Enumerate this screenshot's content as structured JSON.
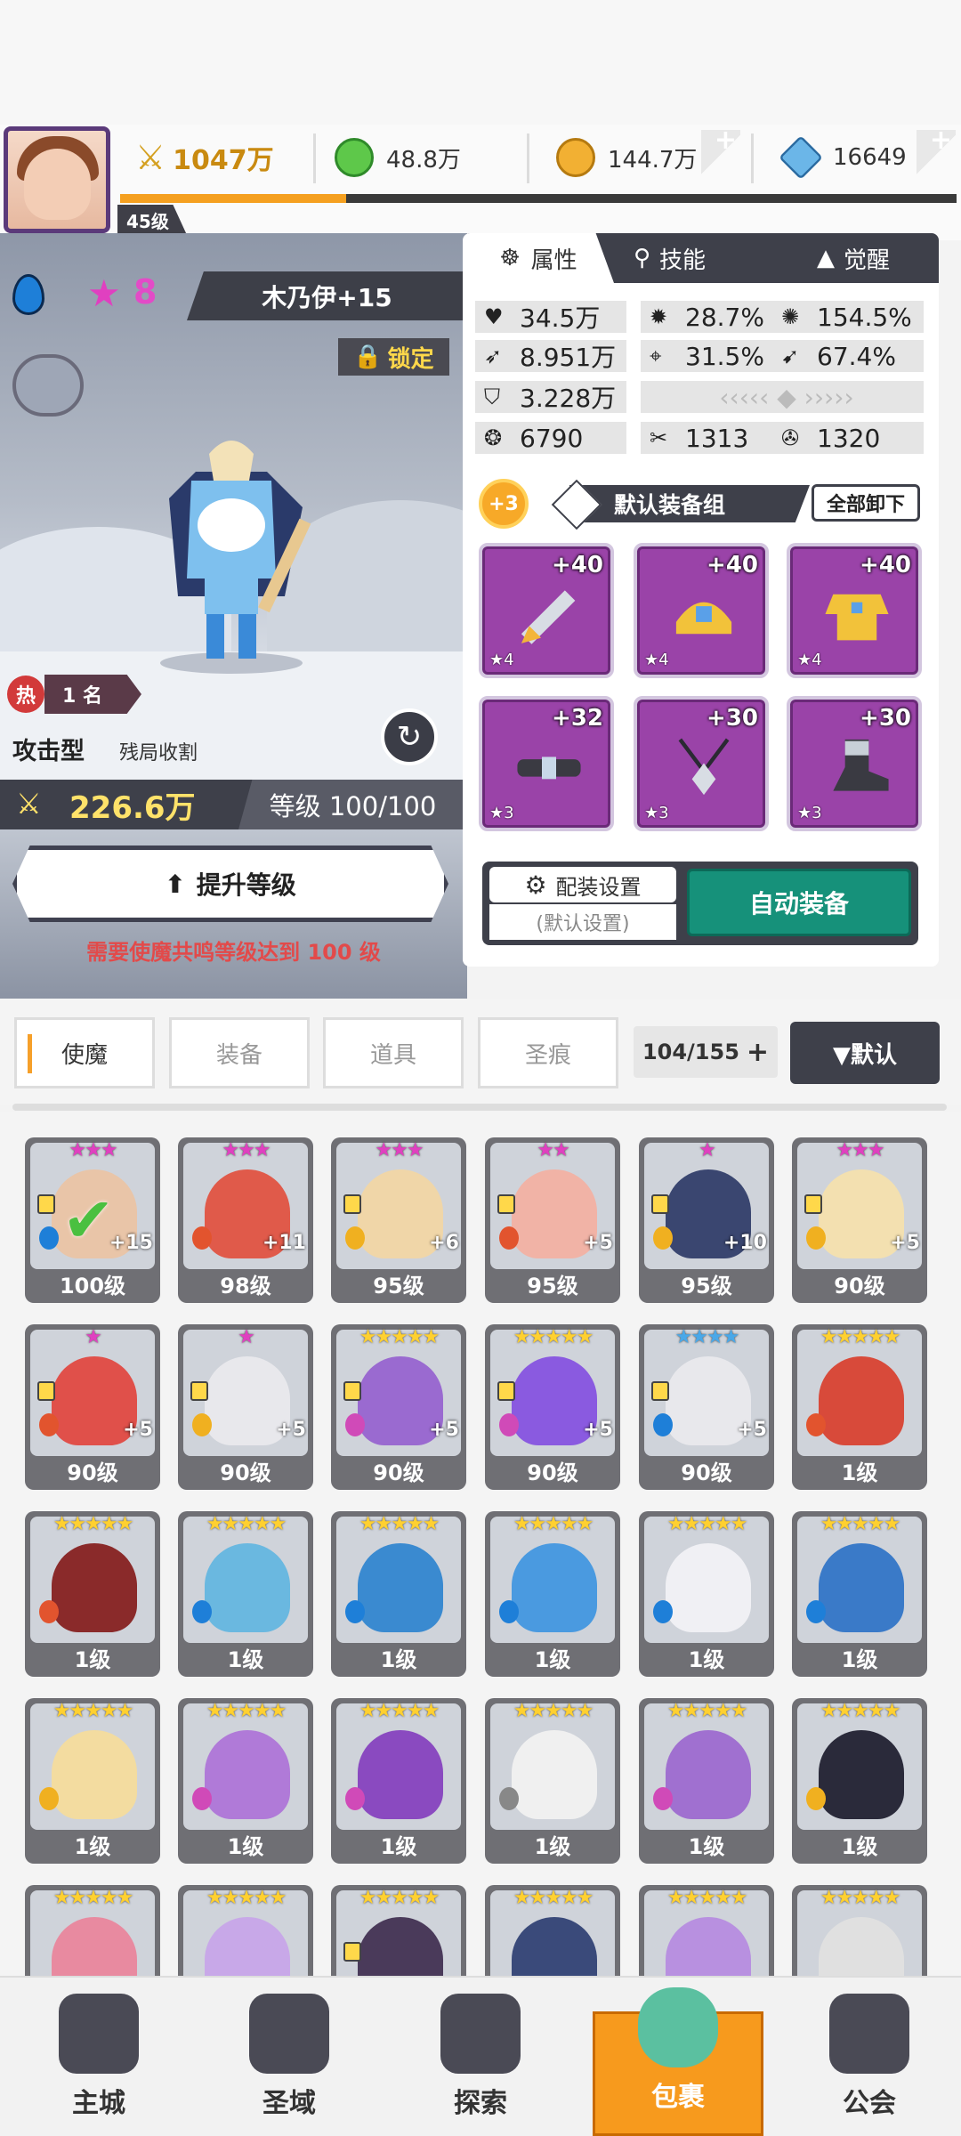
{
  "header": {
    "combat_power": "1047万",
    "currencies": [
      {
        "name": "green-gem",
        "value": "48.8万",
        "color": "#5ec84a"
      },
      {
        "name": "gold-coin",
        "value": "144.7万",
        "color": "#f2b033"
      },
      {
        "name": "blue-crystal",
        "value": "16649",
        "color": "#6bb6e8"
      }
    ],
    "player_level": "45级",
    "xp_progress": 0.27
  },
  "hero": {
    "stars": "8",
    "name": "木乃伊+15",
    "lock_label": "锁定",
    "rank_label": "1 名",
    "rank_icon": "热",
    "type": "攻击型",
    "type_desc": "残局收割",
    "power": "226.6万",
    "level": "等级 100/100",
    "upgrade_label": "提升等级",
    "warning": "需要使魔共鸣等级达到 100 级"
  },
  "attr_panel": {
    "tabs": {
      "attributes": "属性",
      "skills": "技能",
      "awaken": "觉醒"
    },
    "stats": [
      {
        "icon": "heart-icon",
        "glyph": "♥",
        "value": "34.5万"
      },
      {
        "icon": "crit-icon",
        "glyph": "✹",
        "value": "28.7%"
      },
      {
        "icon": "crit-damage-icon",
        "glyph": "✺",
        "value": "154.5%"
      },
      {
        "icon": "attack-icon",
        "glyph": "➶",
        "value": "8.951万"
      },
      {
        "icon": "accuracy-icon",
        "glyph": "⌖",
        "value": "31.5%"
      },
      {
        "icon": "dodge-icon",
        "glyph": "➹",
        "value": "67.4%"
      },
      {
        "icon": "shield-icon",
        "glyph": "⛉",
        "value": "3.228万"
      },
      {
        "icon": "speed-icon",
        "glyph": "❂",
        "value": "6790"
      },
      {
        "icon": "skill-a-icon",
        "glyph": "✂",
        "value": "1313"
      },
      {
        "icon": "skill-b-icon",
        "glyph": "✇",
        "value": "1320"
      }
    ],
    "gear_group_badge": "+3",
    "gear_group_name": "默认装备组",
    "unequip_all": "全部卸下",
    "equipment": [
      {
        "name": "sword",
        "level": "+40",
        "stars": "★4"
      },
      {
        "name": "helmet",
        "level": "+40",
        "stars": "★4"
      },
      {
        "name": "armor",
        "level": "+40",
        "stars": "★4"
      },
      {
        "name": "belt",
        "level": "+32",
        "stars": "★3"
      },
      {
        "name": "necklace",
        "level": "+30",
        "stars": "★3"
      },
      {
        "name": "boots",
        "level": "+30",
        "stars": "★3"
      }
    ],
    "config_label": "配装设置",
    "config_sub": "(默认设置)",
    "auto_equip": "自动装备"
  },
  "inventory": {
    "tabs": [
      "使魔",
      "装备",
      "道具",
      "圣痕"
    ],
    "count": "104/155",
    "sort": "▼默认"
  },
  "heroes": [
    {
      "stars": "★★★",
      "star_color": "#e040c0",
      "level": "100级",
      "plus": "+15",
      "locked": true,
      "element": "#1e7fd8",
      "color": "#e9c5a8"
    },
    {
      "stars": "★★★",
      "star_color": "#e040c0",
      "level": "98级",
      "plus": "+11",
      "locked": false,
      "element": "#e2542e",
      "color": "#e05a4a"
    },
    {
      "stars": "★★★",
      "star_color": "#e040c0",
      "level": "95级",
      "plus": "+6",
      "locked": true,
      "element": "#f0b020",
      "color": "#f0d6a8"
    },
    {
      "stars": "★★",
      "star_color": "#e040c0",
      "level": "95级",
      "plus": "+5",
      "locked": true,
      "element": "#e2542e",
      "color": "#f1b3a6"
    },
    {
      "stars": "★",
      "star_color": "#e040c0",
      "level": "95级",
      "plus": "+10",
      "locked": true,
      "element": "#f0b020",
      "color": "#3a4670"
    },
    {
      "stars": "★★★",
      "star_color": "#e040c0",
      "level": "90级",
      "plus": "+5",
      "locked": true,
      "element": "#f0b020",
      "color": "#f3e0b0"
    },
    {
      "stars": "★",
      "star_color": "#e040c0",
      "level": "90级",
      "plus": "+5",
      "locked": true,
      "element": "#e2542e",
      "color": "#e0504a"
    },
    {
      "stars": "★",
      "star_color": "#e040c0",
      "level": "90级",
      "plus": "+5",
      "locked": true,
      "element": "#f0b020",
      "color": "#e8e8ec"
    },
    {
      "stars": "★★★★★",
      "star_color": "#ffd030",
      "level": "90级",
      "plus": "+5",
      "locked": true,
      "element": "#d04ab8",
      "color": "#9a6ad0"
    },
    {
      "stars": "★★★★★",
      "star_color": "#ffd030",
      "level": "90级",
      "plus": "+5",
      "locked": true,
      "element": "#d04ab8",
      "color": "#8a5ae0"
    },
    {
      "stars": "★★★★",
      "star_color": "#4aa8e8",
      "level": "90级",
      "plus": "+5",
      "locked": true,
      "element": "#1e7fd8",
      "color": "#e8e8ec"
    },
    {
      "stars": "★★★★★",
      "star_color": "#ffd030",
      "level": "1级",
      "plus": "",
      "locked": false,
      "element": "#e2542e",
      "color": "#d84a3a"
    },
    {
      "stars": "★★★★★",
      "star_color": "#ffd030",
      "level": "1级",
      "plus": "",
      "locked": false,
      "element": "#e2542e",
      "color": "#8a2a2a"
    },
    {
      "stars": "★★★★★",
      "star_color": "#ffd030",
      "level": "1级",
      "plus": "",
      "locked": false,
      "element": "#1e7fd8",
      "color": "#6ab8e0"
    },
    {
      "stars": "★★★★★",
      "star_color": "#ffd030",
      "level": "1级",
      "plus": "",
      "locked": false,
      "element": "#1e7fd8",
      "color": "#3a8ad0"
    },
    {
      "stars": "★★★★★",
      "star_color": "#ffd030",
      "level": "1级",
      "plus": "",
      "locked": false,
      "element": "#1e7fd8",
      "color": "#4a9ae0"
    },
    {
      "stars": "★★★★★",
      "star_color": "#ffd030",
      "level": "1级",
      "plus": "",
      "locked": false,
      "element": "#1e7fd8",
      "color": "#f0f0f4"
    },
    {
      "stars": "★★★★★",
      "star_color": "#ffd030",
      "level": "1级",
      "plus": "",
      "locked": false,
      "element": "#1e7fd8",
      "color": "#3a7ac8"
    },
    {
      "stars": "★★★★★",
      "star_color": "#ffd030",
      "level": "1级",
      "plus": "",
      "locked": false,
      "element": "#f0b020",
      "color": "#f3dca0"
    },
    {
      "stars": "★★★★★",
      "star_color": "#ffd030",
      "level": "1级",
      "plus": "",
      "locked": false,
      "element": "#d04ab8",
      "color": "#b07ad8"
    },
    {
      "stars": "★★★★★",
      "star_color": "#ffd030",
      "level": "1级",
      "plus": "",
      "locked": false,
      "element": "#d04ab8",
      "color": "#8a4ac0"
    },
    {
      "stars": "★★★★★",
      "star_color": "#ffd030",
      "level": "1级",
      "plus": "",
      "locked": false,
      "element": "#888888",
      "color": "#f0f0f0"
    },
    {
      "stars": "★★★★★",
      "star_color": "#ffd030",
      "level": "1级",
      "plus": "",
      "locked": false,
      "element": "#d04ab8",
      "color": "#a070d0"
    },
    {
      "stars": "★★★★★",
      "star_color": "#ffd030",
      "level": "1级",
      "plus": "",
      "locked": false,
      "element": "#f0b020",
      "color": "#2a2a3a"
    },
    {
      "stars": "★★★★★",
      "star_color": "#ffd030",
      "level": "",
      "plus": "",
      "locked": false,
      "element": "",
      "color": "#e88aa0"
    },
    {
      "stars": "★★★★★",
      "star_color": "#ffd030",
      "level": "",
      "plus": "",
      "locked": false,
      "element": "",
      "color": "#c8a8e8"
    },
    {
      "stars": "★★★★★",
      "star_color": "#ffd030",
      "level": "",
      "plus": "",
      "locked": true,
      "element": "",
      "color": "#4a3a5a"
    },
    {
      "stars": "★★★★★",
      "star_color": "#ffd030",
      "level": "",
      "plus": "",
      "locked": false,
      "element": "",
      "color": "#3a4a7a"
    },
    {
      "stars": "★★★★★",
      "star_color": "#ffd030",
      "level": "",
      "plus": "",
      "locked": false,
      "element": "",
      "color": "#b890e0"
    },
    {
      "stars": "★★★★★",
      "star_color": "#ffd030",
      "level": "",
      "plus": "",
      "locked": false,
      "element": "",
      "color": "#e0e0e0"
    }
  ],
  "bottom_nav": [
    {
      "label": "主城",
      "active": false
    },
    {
      "label": "圣域",
      "active": false
    },
    {
      "label": "探索",
      "active": false
    },
    {
      "label": "包裹",
      "active": true
    },
    {
      "label": "公会",
      "active": false
    }
  ]
}
